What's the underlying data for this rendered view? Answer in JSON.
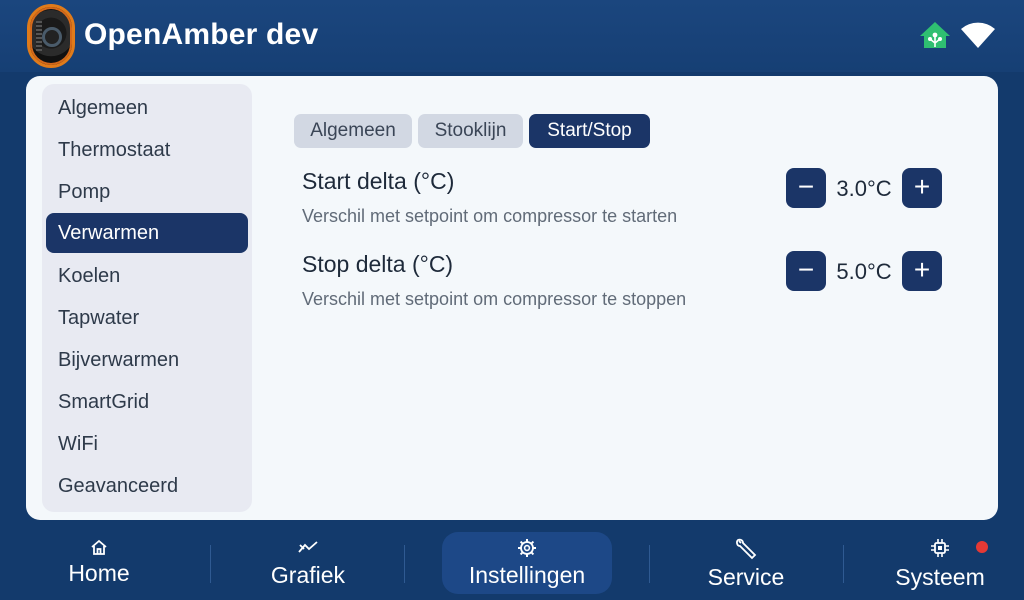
{
  "app": {
    "title": "OpenAmber dev"
  },
  "sidebar": {
    "items": [
      {
        "label": "Algemeen",
        "active": false
      },
      {
        "label": "Thermostaat",
        "active": false
      },
      {
        "label": "Pomp",
        "active": false
      },
      {
        "label": "Verwarmen",
        "active": true
      },
      {
        "label": "Koelen",
        "active": false
      },
      {
        "label": "Tapwater",
        "active": false
      },
      {
        "label": "Bijverwarmen",
        "active": false
      },
      {
        "label": "SmartGrid",
        "active": false
      },
      {
        "label": "WiFi",
        "active": false
      },
      {
        "label": "Geavanceerd",
        "active": false
      }
    ]
  },
  "tabs": [
    {
      "label": "Algemeen",
      "active": false
    },
    {
      "label": "Stooklijn",
      "active": false
    },
    {
      "label": "Start/Stop",
      "active": true
    }
  ],
  "settings": [
    {
      "title": "Start delta (°C)",
      "description": "Verschil met setpoint om compressor te starten",
      "value": "3.0°C"
    },
    {
      "title": "Stop delta (°C)",
      "description": "Verschil met setpoint om compressor te stoppen",
      "value": "5.0°C"
    }
  ],
  "stepper": {
    "minus": "−",
    "plus": "+"
  },
  "nav": [
    {
      "label": "Home",
      "icon": "home-icon",
      "active": false
    },
    {
      "label": "Grafiek",
      "icon": "chart-icon",
      "active": false
    },
    {
      "label": "Instellingen",
      "icon": "gear-icon",
      "active": true
    },
    {
      "label": "Service",
      "icon": "wrench-icon",
      "active": false
    },
    {
      "label": "Systeem",
      "icon": "chip-icon",
      "active": false
    }
  ],
  "colors": {
    "background": "#133a6c",
    "accent": "#1b3567",
    "panel": "#f4f8fb",
    "sidebar": "#e8eaf2",
    "home_assistant": "#2fbf71",
    "alert_dot": "#e53935"
  }
}
